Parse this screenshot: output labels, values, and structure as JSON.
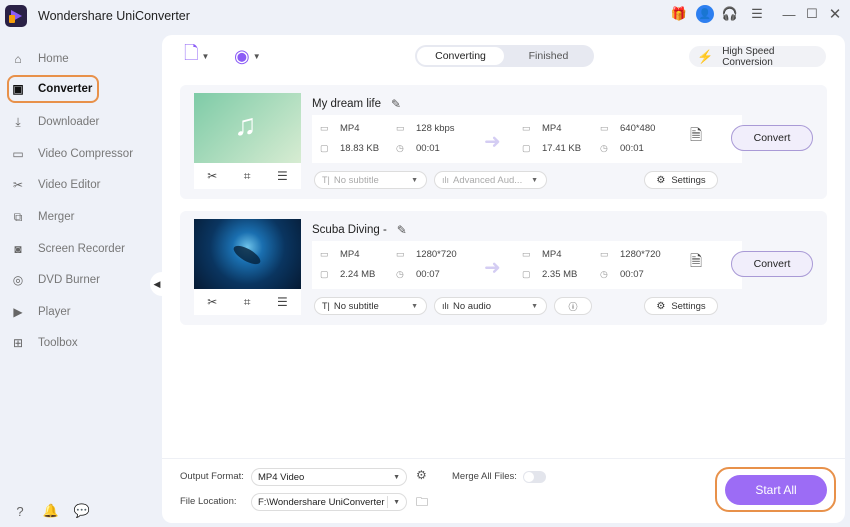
{
  "app": {
    "title": "Wondershare UniConverter"
  },
  "titlebar_icons": [
    "gift-icon",
    "account-icon",
    "support-icon",
    "menu-icon",
    "minimize-icon",
    "maximize-icon",
    "close-icon"
  ],
  "sidebar": {
    "items": [
      {
        "label": "Home",
        "icon": "home-icon"
      },
      {
        "label": "Converter",
        "icon": "converter-icon",
        "active": true
      },
      {
        "label": "Downloader",
        "icon": "downloader-icon"
      },
      {
        "label": "Video Compressor",
        "icon": "compressor-icon"
      },
      {
        "label": "Video Editor",
        "icon": "editor-icon"
      },
      {
        "label": "Merger",
        "icon": "merger-icon"
      },
      {
        "label": "Screen Recorder",
        "icon": "screen-recorder-icon"
      },
      {
        "label": "DVD Burner",
        "icon": "dvd-icon"
      },
      {
        "label": "Player",
        "icon": "player-icon"
      },
      {
        "label": "Toolbox",
        "icon": "toolbox-icon"
      }
    ],
    "bottom_icons": [
      "help-icon",
      "notification-icon",
      "feedback-icon"
    ]
  },
  "toolbar": {
    "tabs": [
      {
        "label": "Converting",
        "active": true
      },
      {
        "label": "Finished"
      }
    ],
    "high_speed_label": "High Speed Conversion"
  },
  "files": [
    {
      "title": "My dream life",
      "thumb": "audio",
      "source": {
        "format": "MP4",
        "quality": "128 kbps",
        "size": "18.83 KB",
        "duration": "00:01"
      },
      "target": {
        "format": "MP4",
        "resolution": "640*480",
        "size": "17.41 KB",
        "duration": "00:01"
      },
      "subtitle": "No subtitle",
      "audio": "Advanced Aud...",
      "disabled_selects": true,
      "settings_label": "Settings",
      "convert_label": "Convert"
    },
    {
      "title": "Scuba Diving -",
      "thumb": "video",
      "source": {
        "format": "MP4",
        "quality": "1280*720",
        "size": "2.24 MB",
        "duration": "00:07"
      },
      "target": {
        "format": "MP4",
        "resolution": "1280*720",
        "size": "2.35 MB",
        "duration": "00:07"
      },
      "subtitle": "No subtitle",
      "audio": "No audio",
      "disabled_selects": false,
      "settings_label": "Settings",
      "convert_label": "Convert"
    }
  ],
  "footer": {
    "output_format_label": "Output Format:",
    "output_format_value": "MP4 Video",
    "merge_label": "Merge All Files:",
    "merge_on": false,
    "file_location_label": "File Location:",
    "file_location_value": "F:\\Wondershare UniConverter",
    "start_all_label": "Start All"
  },
  "colors": {
    "accent": "#9c6cf5",
    "highlight": "#e8914a"
  }
}
